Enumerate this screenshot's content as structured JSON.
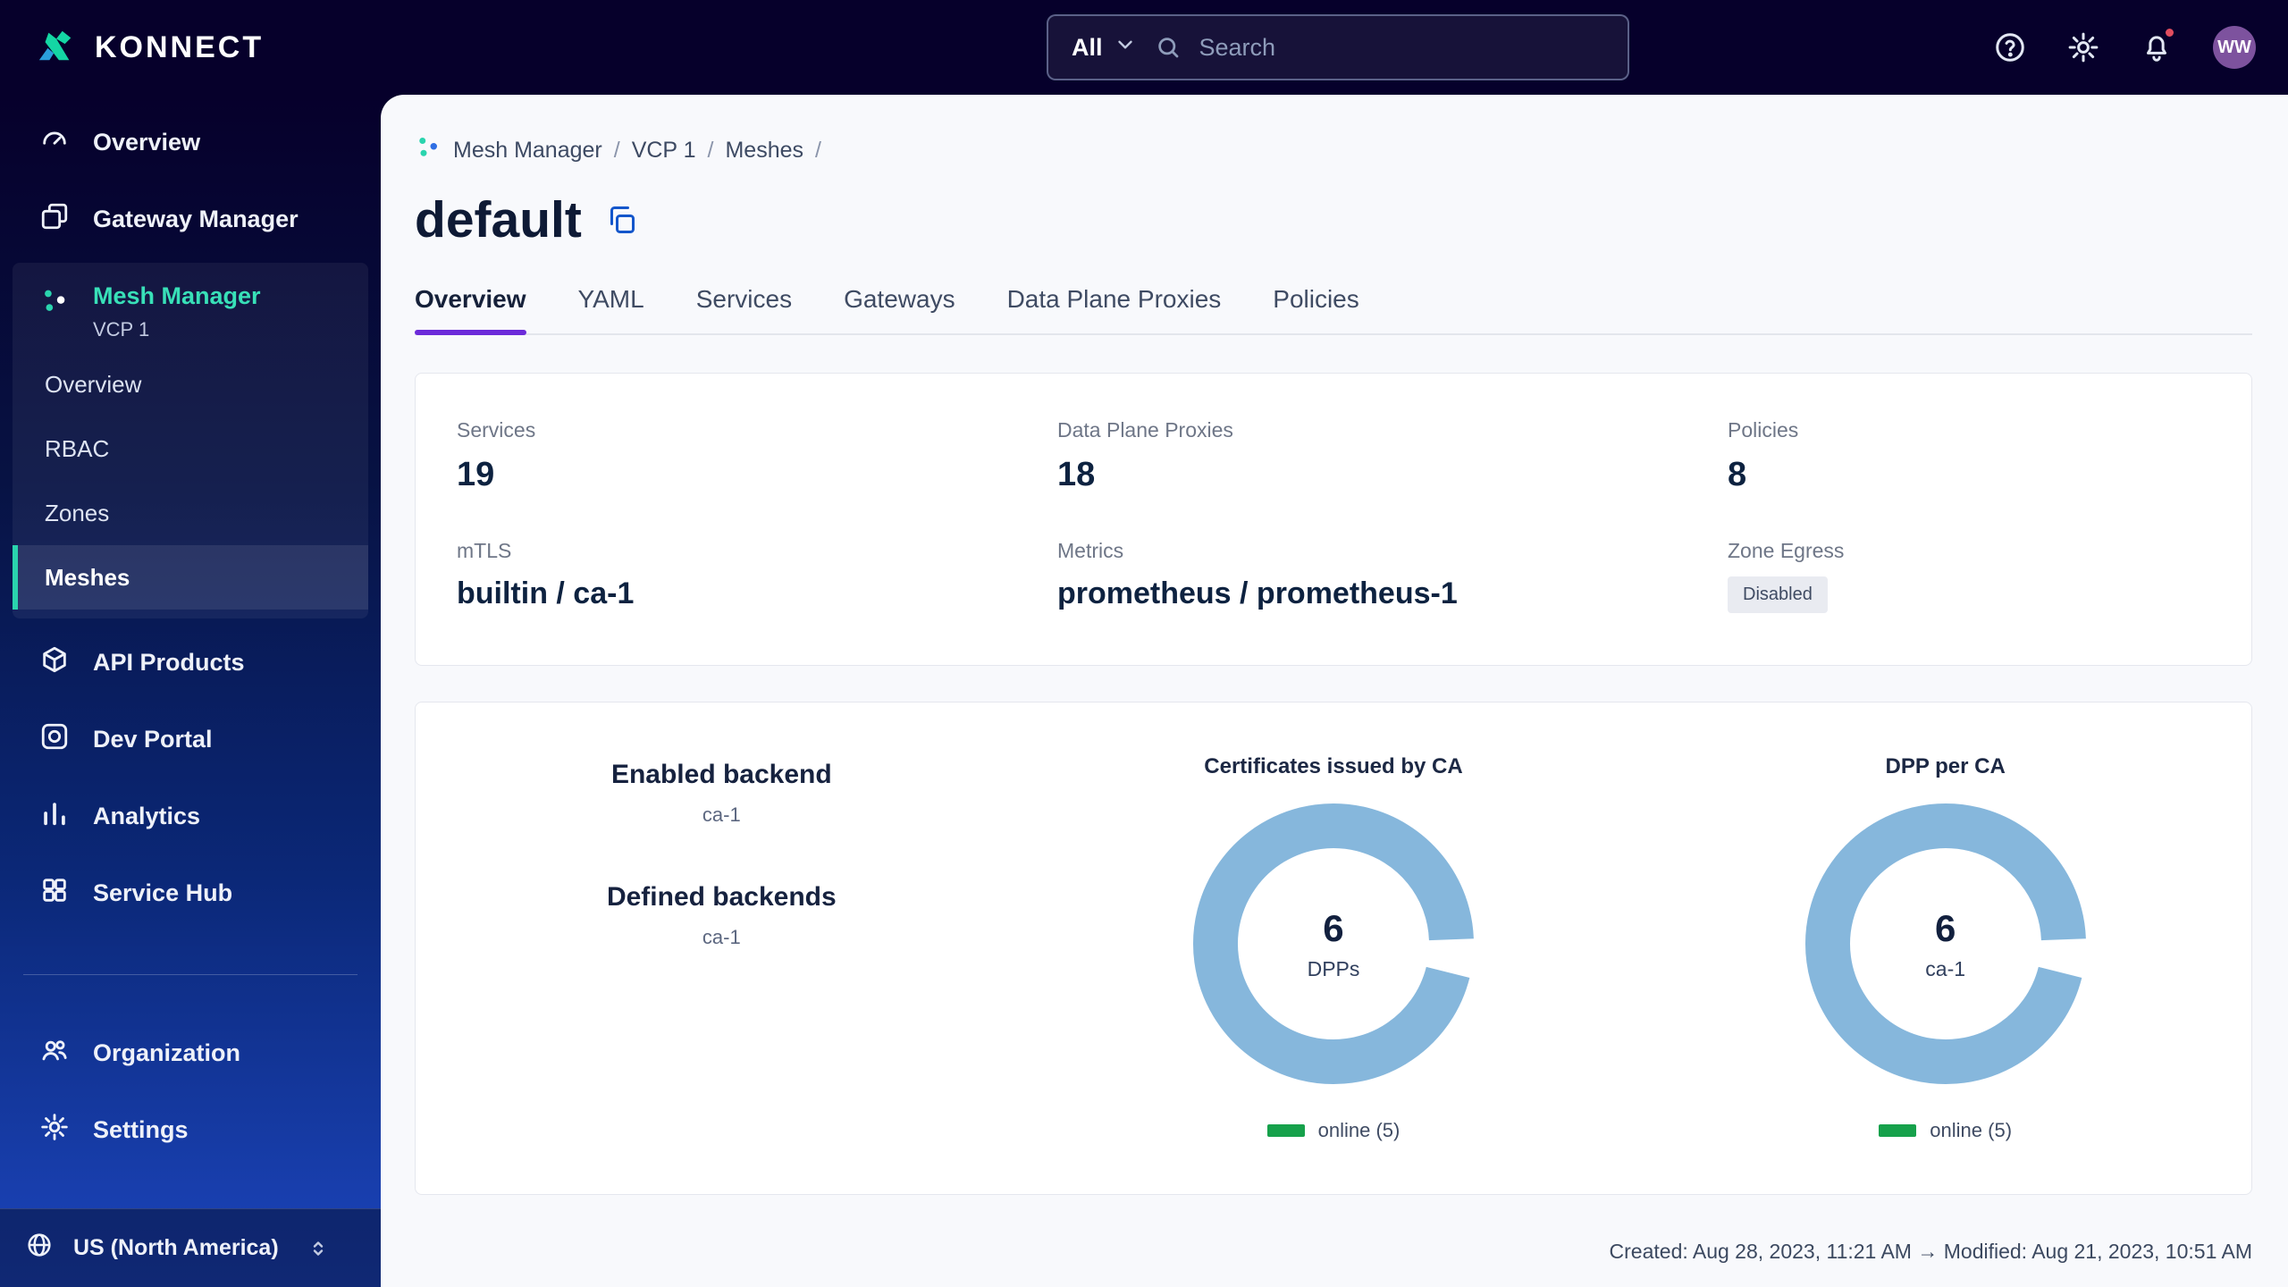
{
  "header": {
    "brand": "KONNECT",
    "search_scope": "All",
    "search_placeholder": "Search",
    "avatar_initials": "WW"
  },
  "sidebar": {
    "overview": "Overview",
    "gateway_manager": "Gateway Manager",
    "mesh_manager": {
      "label": "Mesh Manager",
      "instance": "VCP 1",
      "children": {
        "overview": "Overview",
        "rbac": "RBAC",
        "zones": "Zones",
        "meshes": "Meshes"
      }
    },
    "api_products": "API Products",
    "dev_portal": "Dev Portal",
    "analytics": "Analytics",
    "service_hub": "Service Hub",
    "organization": "Organization",
    "settings": "Settings",
    "region": "US (North America)"
  },
  "breadcrumb": {
    "items": [
      "Mesh Manager",
      "VCP 1",
      "Meshes"
    ],
    "separator": "/"
  },
  "page_title": "default",
  "tabs": {
    "items": [
      "Overview",
      "YAML",
      "Services",
      "Gateways",
      "Data Plane Proxies",
      "Policies"
    ],
    "active": "Overview"
  },
  "overview_card": {
    "services_label": "Services",
    "services_value": "19",
    "dpp_label": "Data Plane Proxies",
    "dpp_value": "18",
    "policies_label": "Policies",
    "policies_value": "8",
    "mtls_label": "mTLS",
    "mtls_value": "builtin / ca-1",
    "metrics_label": "Metrics",
    "metrics_value": "prometheus / prometheus-1",
    "zone_egress_label": "Zone Egress",
    "zone_egress_value": "Disabled"
  },
  "insights_card": {
    "enabled_backend_label": "Enabled backend",
    "enabled_backend_value": "ca-1",
    "defined_backends_label": "Defined backends",
    "defined_backends_value": "ca-1",
    "cert_chart": {
      "title": "Certificates issued by CA",
      "center_value": "6",
      "center_label": "DPPs",
      "legend": "online (5)"
    },
    "dpp_chart": {
      "title": "DPP per CA",
      "center_value": "6",
      "center_label": "ca-1",
      "legend": "online (5)"
    }
  },
  "chart_data": [
    {
      "type": "donut",
      "title": "Certificates issued by CA",
      "center_value": 6,
      "center_label": "DPPs",
      "segments": [
        {
          "label": "online",
          "value": 5,
          "color": "#16a14b"
        }
      ],
      "ring_color": "#86b7dc",
      "legend_position": "bottom"
    },
    {
      "type": "donut",
      "title": "DPP per CA",
      "center_value": 6,
      "center_label": "ca-1",
      "segments": [
        {
          "label": "online",
          "value": 5,
          "color": "#16a14b"
        }
      ],
      "ring_color": "#86b7dc",
      "legend_position": "bottom"
    }
  ],
  "footer": {
    "audit": "Created: Aug 28, 2023, 11:21 AM → Modified: Aug 21, 2023, 10:51 AM"
  },
  "colors": {
    "header_bg": "#06002b",
    "sidebar_bottom": "#1c45bd",
    "accent_teal": "#2ad4ae",
    "accent_purple": "#6c2bd9",
    "link_blue": "#1456cb",
    "ring_blue": "#86b7dc",
    "legend_green": "#16a14b",
    "notification_red": "#e14d5f"
  }
}
